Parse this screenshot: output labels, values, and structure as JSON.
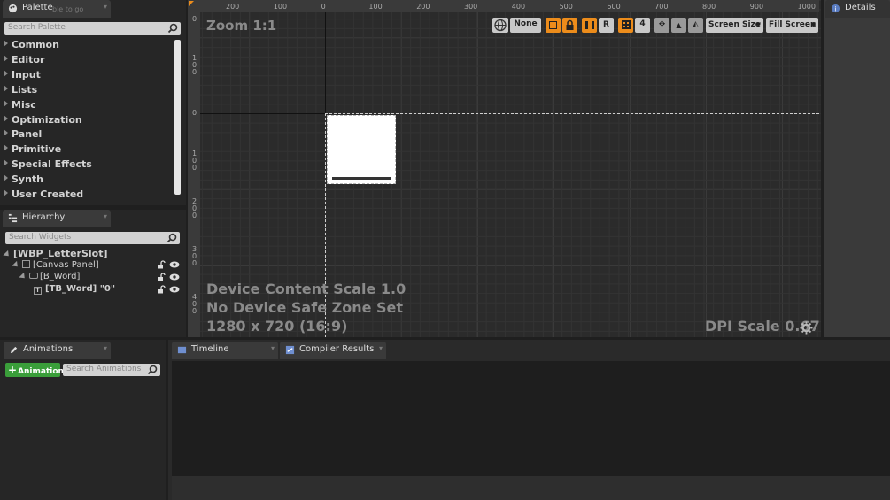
{
  "palette": {
    "tab_label": "Palette",
    "tab_overlay_hint": "ble to go",
    "search_placeholder": "Search Palette",
    "categories": [
      "Common",
      "Editor",
      "Input",
      "Lists",
      "Misc",
      "Optimization",
      "Panel",
      "Primitive",
      "Special Effects",
      "Synth",
      "User Created"
    ]
  },
  "hierarchy": {
    "tab_label": "Hierarchy",
    "search_placeholder": "Search Widgets",
    "items": [
      {
        "label": "[WBP_LetterSlot]",
        "bold": true
      },
      {
        "label": "[Canvas Panel]",
        "bold": false
      },
      {
        "label": "[B_Word]",
        "bold": false
      },
      {
        "label": "[TB_Word] \"0\"",
        "bold": true
      }
    ]
  },
  "designer": {
    "zoom_label": "Zoom 1:1",
    "toolbar": {
      "localize_label": "None",
      "r_label": "R",
      "grid_snap_value": "4",
      "screen_size_label": "Screen Size",
      "fill_screen_label": "Fill Screen"
    },
    "ruler_top": [
      "200",
      "100",
      "0",
      "100",
      "200",
      "300",
      "400",
      "500",
      "600",
      "700",
      "800",
      "900",
      "1000"
    ],
    "ruler_left": [
      "0",
      "100",
      "0",
      "100",
      "200",
      "300",
      "400"
    ],
    "info": {
      "content_scale": "Device Content Scale 1.0",
      "safe_zone": "No Device Safe Zone Set",
      "resolution": "1280 x 720 (16:9)",
      "dpi_scale": "DPI Scale 0.67"
    }
  },
  "details": {
    "tab_label": "Details"
  },
  "animations": {
    "tab_label": "Animations",
    "add_button": "Animation",
    "search_placeholder": "Search Animations"
  },
  "bottom_tabs": [
    {
      "label": "Timeline"
    },
    {
      "label": "Compiler Results"
    }
  ],
  "colors": {
    "accent_orange": "#ec8c1b",
    "add_green": "#3a9e3a"
  }
}
